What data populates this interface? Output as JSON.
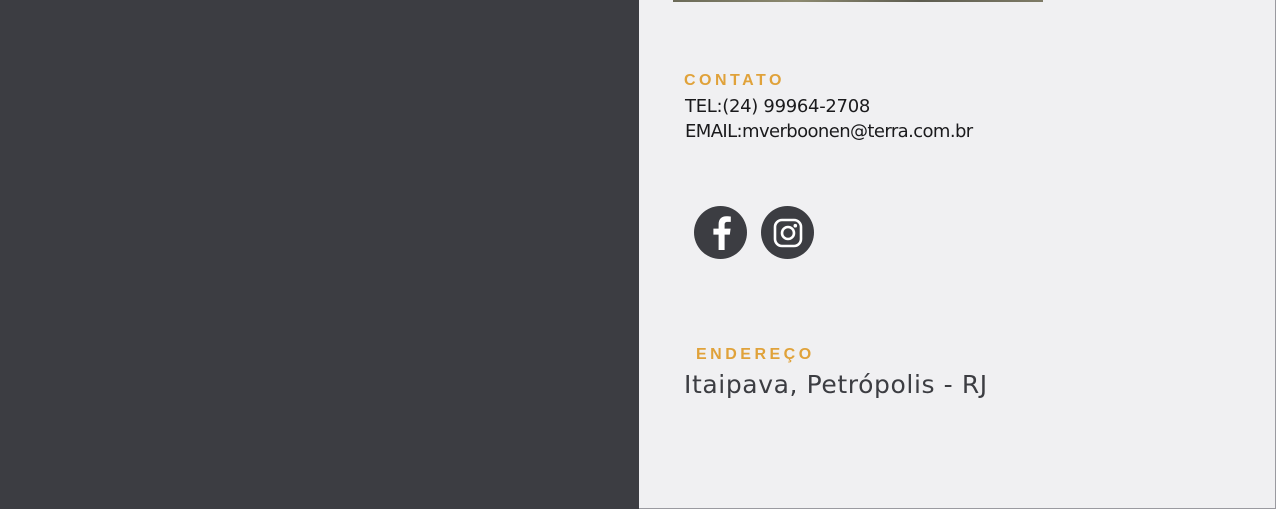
{
  "contact": {
    "heading": "CONTATO",
    "tel": "TEL:(24) 99964-2708",
    "email": "EMAIL:mverboonen@terra.com.br"
  },
  "social": {
    "links": [
      {
        "icon": "facebook-icon"
      },
      {
        "icon": "instagram-icon"
      }
    ]
  },
  "address": {
    "heading": "ENDEREÇO",
    "text": "Itaipava, Petrópolis - RJ"
  },
  "colors": {
    "accent": "#e0a23a",
    "dark_panel": "#3c3d42",
    "light_panel": "#f0f0f2",
    "text": "#1a1a1c"
  }
}
